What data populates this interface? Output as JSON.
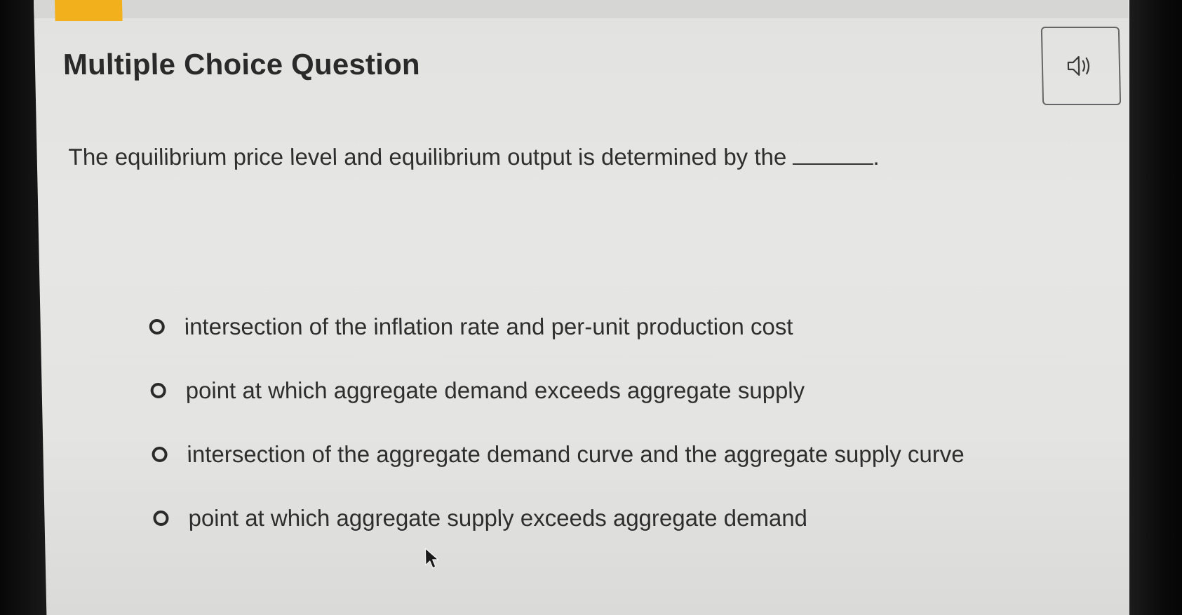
{
  "header": {
    "title": "Multiple Choice Question"
  },
  "question": {
    "prompt": "The equilibrium price level and equilibrium output is determined by the",
    "trailing_punctuation": "."
  },
  "options": [
    {
      "label": "intersection of the inflation rate and per-unit production cost"
    },
    {
      "label": "point at which aggregate demand exceeds aggregate supply"
    },
    {
      "label": "intersection of the aggregate demand curve and the aggregate supply curve"
    },
    {
      "label": "point at which aggregate supply exceeds aggregate demand"
    }
  ],
  "icons": {
    "audio": "speaker-icon",
    "pointer": "mouse-pointer-icon"
  },
  "colors": {
    "accent": "#f2b11c",
    "text": "#2e2e2e",
    "background": "#e4e4e2"
  }
}
